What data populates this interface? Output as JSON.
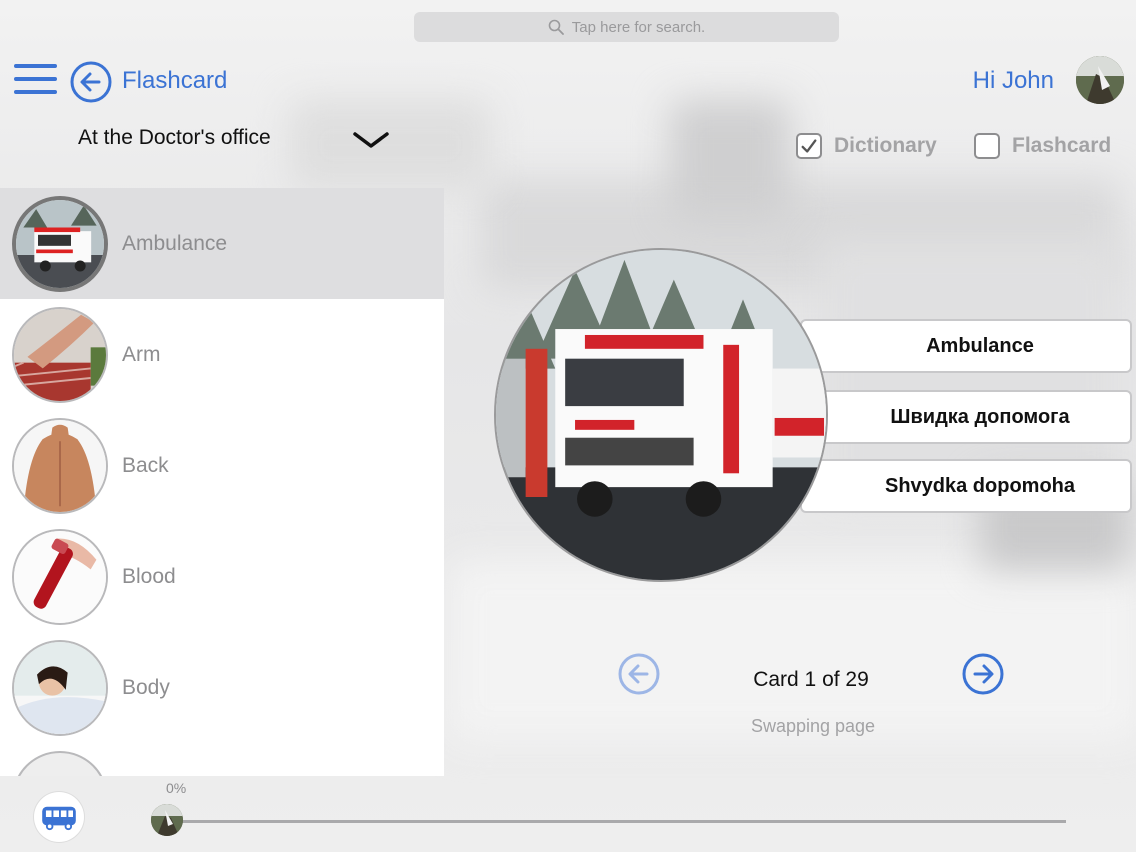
{
  "search": {
    "placeholder": "Tap here for search."
  },
  "header": {
    "title": "Flashcard",
    "greeting": "Hi John"
  },
  "category": {
    "selected": "At the Doctor's office"
  },
  "options": [
    {
      "label": "Dictionary",
      "checked": true
    },
    {
      "label": "Flashcard",
      "checked": false
    }
  ],
  "list": {
    "items": [
      {
        "label": "Ambulance",
        "icon": "ambulance-photo",
        "active": true
      },
      {
        "label": "Arm",
        "icon": "arm-photo",
        "active": false
      },
      {
        "label": "Back",
        "icon": "back-photo",
        "active": false
      },
      {
        "label": "Blood",
        "icon": "blood-photo",
        "active": false
      },
      {
        "label": "Body",
        "icon": "body-photo",
        "active": false
      }
    ]
  },
  "card": {
    "english": "Ambulance",
    "ukrainian": "Швидка допомога",
    "transliteration": "Shvydka dopomoha",
    "counter": "Card 1 of 29",
    "status": "Swapping page"
  },
  "progress": {
    "label": "0%",
    "value": 0
  },
  "colors": {
    "accent": "#3b73d4",
    "muted": "#8d8d8f",
    "panel": "#ffffff",
    "active_row": "#dedee0"
  }
}
